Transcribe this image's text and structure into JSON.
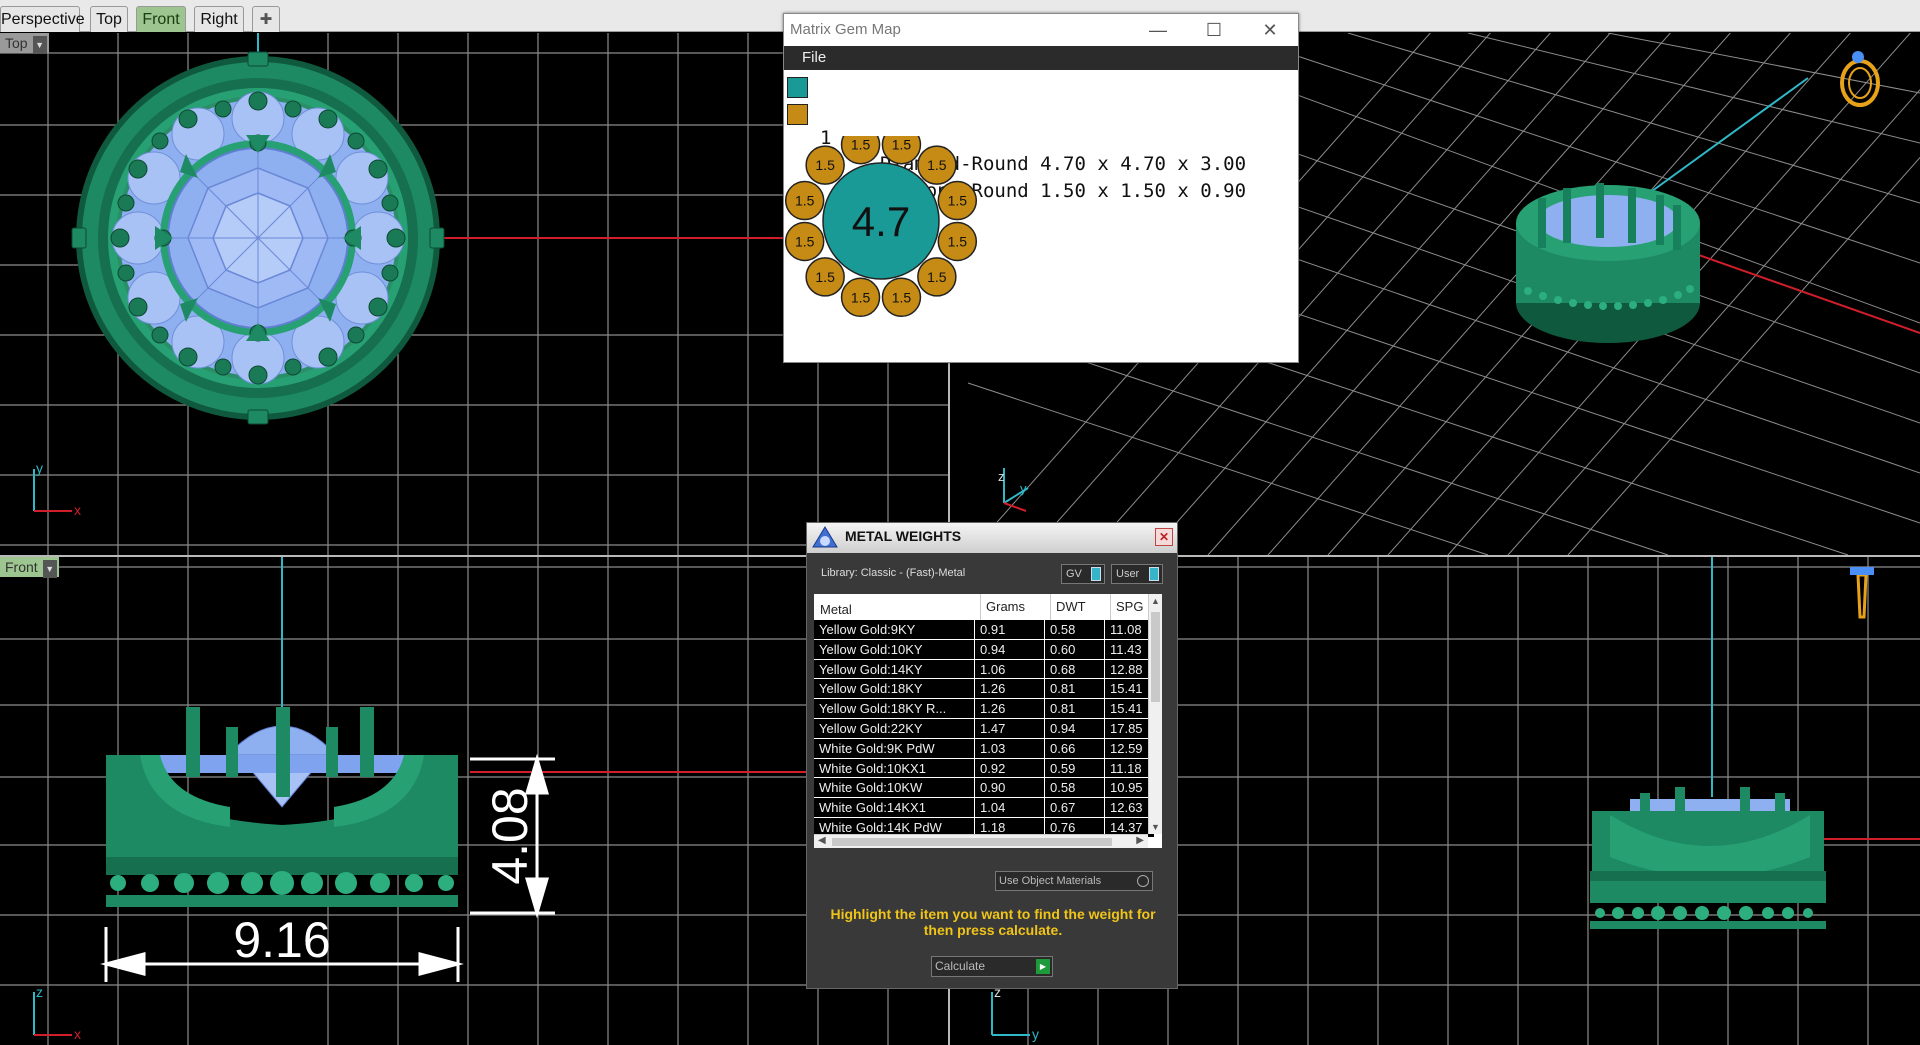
{
  "tabs": [
    {
      "label": "Perspective",
      "active": false
    },
    {
      "label": "Top",
      "active": false
    },
    {
      "label": "Front",
      "active": true
    },
    {
      "label": "Right",
      "active": false
    }
  ],
  "tab_add_icon": "plus-icon",
  "viewports": {
    "top": {
      "label": "Top"
    },
    "front": {
      "label": "Front"
    }
  },
  "axes": {
    "top": {
      "v": "y",
      "h": "x"
    },
    "perspective": {
      "v": "z",
      "h": "y"
    },
    "front": {
      "v": "z",
      "h": "x"
    },
    "right": {
      "v": "z",
      "h": "y"
    }
  },
  "dimensions": {
    "width": "9.16",
    "height": "4.08"
  },
  "gem_map": {
    "title": "Matrix Gem Map",
    "menu": "File",
    "rows": [
      {
        "count": "1",
        "desc": "Diamond-Round 4.70 x 4.70 x 3.00",
        "color": "#1a9a97"
      },
      {
        "count": "12",
        "desc": "Diamond-Round 1.50 x 1.50 x 0.90",
        "color": "#c58b15"
      }
    ],
    "center_label": "4.7",
    "small_label": "1.5"
  },
  "metal_weights": {
    "title": "METAL WEIGHTS",
    "library": "Library: Classic - (Fast)-Metal",
    "toggle_gv": "GV",
    "toggle_user": "User",
    "columns": [
      "Metal",
      "Grams",
      "DWT",
      "SPG"
    ],
    "rows": [
      [
        "Yellow Gold:9KY",
        "0.91",
        "0.58",
        "11.08"
      ],
      [
        "Yellow Gold:10KY",
        "0.94",
        "0.60",
        "11.43"
      ],
      [
        "Yellow Gold:14KY",
        "1.06",
        "0.68",
        "12.88"
      ],
      [
        "Yellow Gold:18KY",
        "1.26",
        "0.81",
        "15.41"
      ],
      [
        "Yellow Gold:18KY R...",
        "1.26",
        "0.81",
        "15.41"
      ],
      [
        "Yellow Gold:22KY",
        "1.47",
        "0.94",
        "17.85"
      ],
      [
        "White Gold:9K PdW",
        "1.03",
        "0.66",
        "12.59"
      ],
      [
        "White Gold:10KX1",
        "0.92",
        "0.59",
        "11.18"
      ],
      [
        "White Gold:10KW",
        "0.90",
        "0.58",
        "10.95"
      ],
      [
        "White Gold:14KX1",
        "1.04",
        "0.67",
        "12.63"
      ],
      [
        "White Gold:14K PdW",
        "1.18",
        "0.76",
        "14.37"
      ]
    ],
    "use_object_materials": "Use Object Materials",
    "message": "Highlight the item you want to find the weight for then press calculate.",
    "calculate": "Calculate"
  },
  "colors": {
    "metal": "#1e8a64",
    "gem": "#8fb0f0",
    "grid": "#8c8c8c",
    "axis_x": "#d01e2a",
    "axis_z": "#2fb8c8",
    "gold_gem": "#c58b15",
    "teal_gem": "#1a9a97"
  }
}
